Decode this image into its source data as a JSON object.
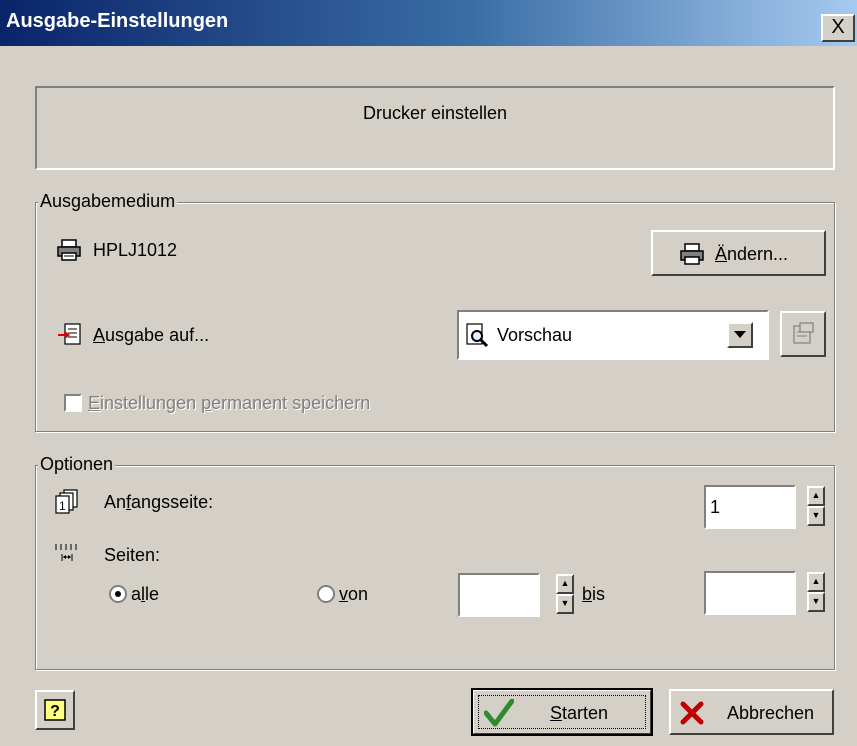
{
  "window": {
    "title": "Ausgabe-Einstellungen",
    "close_label": "X"
  },
  "header": {
    "text": "Drucker einstellen"
  },
  "ausgabemedium": {
    "group_label": "Ausgabemedium",
    "printer_name": "HPLJ1012",
    "change_button": {
      "accel": "Ä",
      "rest": "ndern..."
    },
    "output_label": {
      "accel": "A",
      "rest": "usgabe auf..."
    },
    "output_select_value": "Vorschau",
    "save_checkbox": {
      "pre": "",
      "accel": "E",
      "mid": "instellungen ",
      "accel2": "p",
      "rest": "ermanent speichern",
      "checked": false
    }
  },
  "optionen": {
    "group_label": "Optionen",
    "start_page": {
      "pre": "An",
      "accel": "f",
      "rest": "angsseite:",
      "value": "1"
    },
    "pages_label": "Seiten:",
    "radio_all": {
      "pre": "a",
      "accel": "l",
      "rest": "le",
      "checked": true
    },
    "radio_from": {
      "accel": "v",
      "rest": "on",
      "checked": false
    },
    "from_value": "",
    "to_label": {
      "accel": "b",
      "rest": "is"
    },
    "to_value": ""
  },
  "footer": {
    "help_label": "?",
    "start_button": {
      "accel": "S",
      "rest": "tarten"
    },
    "cancel_button": "Abbrechen"
  }
}
